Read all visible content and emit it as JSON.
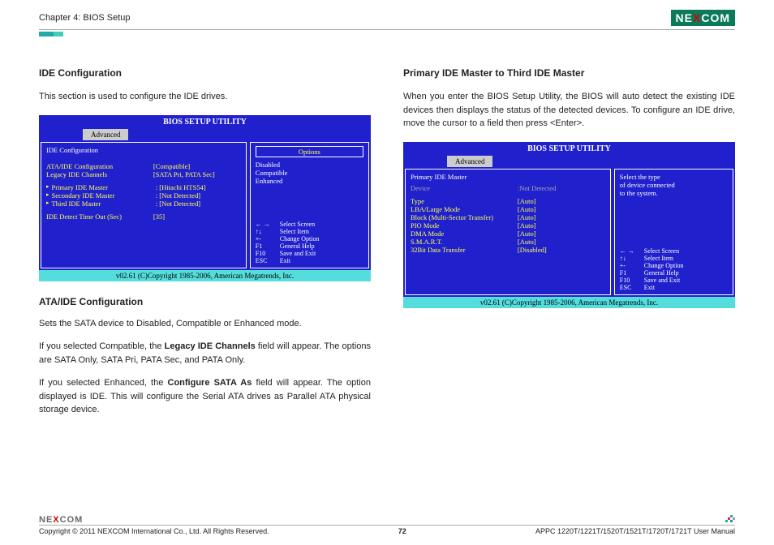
{
  "header": {
    "chapter": "Chapter 4: BIOS Setup",
    "logo_left": "NE",
    "logo_x": "X",
    "logo_right": "COM"
  },
  "left": {
    "h1": "IDE Configuration",
    "p1": "This section is used to configure the IDE drives.",
    "h2": "ATA/IDE Configuration",
    "p2": "Sets the SATA device to Disabled, Compatible or Enhanced mode.",
    "p3a": "If you selected Compatible, the ",
    "p3b": "Legacy IDE Channels",
    "p3c": " field will appear. The options are SATA Only, SATA Pri, PATA Sec, and PATA Only.",
    "p4a": "If you selected Enhanced, the ",
    "p4b": "Configure SATA As",
    "p4c": " field will appear. The option displayed is IDE. This will configure the Serial ATA drives as Parallel ATA physical storage device."
  },
  "right": {
    "h1": "Primary IDE Master to Third IDE Master",
    "p1": "When you enter the BIOS Setup Utility, the BIOS will auto detect the existing IDE devices then displays the status of the detected devices. To configure an IDE drive, move the cursor to a field then press <Enter>."
  },
  "bios_common": {
    "title": "BIOS SETUP UTILITY",
    "tab": "Advanced",
    "footer": "v02.61 (C)Copyright 1985-2006, American Megatrends, Inc.",
    "help": [
      {
        "k": "← →",
        "v": "Select Screen"
      },
      {
        "k": "↑↓",
        "v": "Select Item"
      },
      {
        "k": "+-",
        "v": "Change Option"
      },
      {
        "k": "F1",
        "v": "General Help"
      },
      {
        "k": "F10",
        "v": "Save and Exit"
      },
      {
        "k": "ESC",
        "v": "Exit"
      }
    ]
  },
  "bios1": {
    "section": "IDE Configuration",
    "rows_top": [
      {
        "l": "ATA/IDE Configuration",
        "v": "[Compatible]"
      },
      {
        "l": "Legacy IDE Channels",
        "v": "[SATA Pri, PATA Sec]"
      }
    ],
    "rows_mid": [
      {
        "l": "Primary IDE Master",
        "v": ": [Hitachi HTS54]"
      },
      {
        "l": "Secondary IDE Master",
        "v": ": [Not Detected]"
      },
      {
        "l": "Third IDE Master",
        "v": ": [Not Detected]"
      }
    ],
    "rows_bot": [
      {
        "l": "IDE Detect Time Out (Sec)",
        "v": "[35]"
      }
    ],
    "opt_title": "Options",
    "opts": [
      "Disabled",
      "Compatible",
      "Enhanced"
    ]
  },
  "bios2": {
    "section": "Primary IDE Master",
    "device_l": "Device",
    "device_v": ":Not Detected",
    "rows": [
      {
        "l": "Type",
        "v": "[Auto]"
      },
      {
        "l": "LBA/Large Mode",
        "v": "[Auto]"
      },
      {
        "l": "Block (Multi-Sector Transfer)",
        "v": "[Auto]"
      },
      {
        "l": "PIO Mode",
        "v": "[Auto]"
      },
      {
        "l": "DMA Mode",
        "v": "[Auto]"
      },
      {
        "l": "S.M.A.R.T.",
        "v": "[Auto]"
      },
      {
        "l": "32Bit Data Transfer",
        "v": "[Disabled]"
      }
    ],
    "right_text": [
      "Select the type",
      "of device connected",
      "to the system."
    ]
  },
  "footer": {
    "copyright": "Copyright © 2011 NEXCOM International Co., Ltd. All Rights Reserved.",
    "page": "72",
    "manual": "APPC 1220T/1221T/1520T/1521T/1720T/1721T User Manual"
  }
}
